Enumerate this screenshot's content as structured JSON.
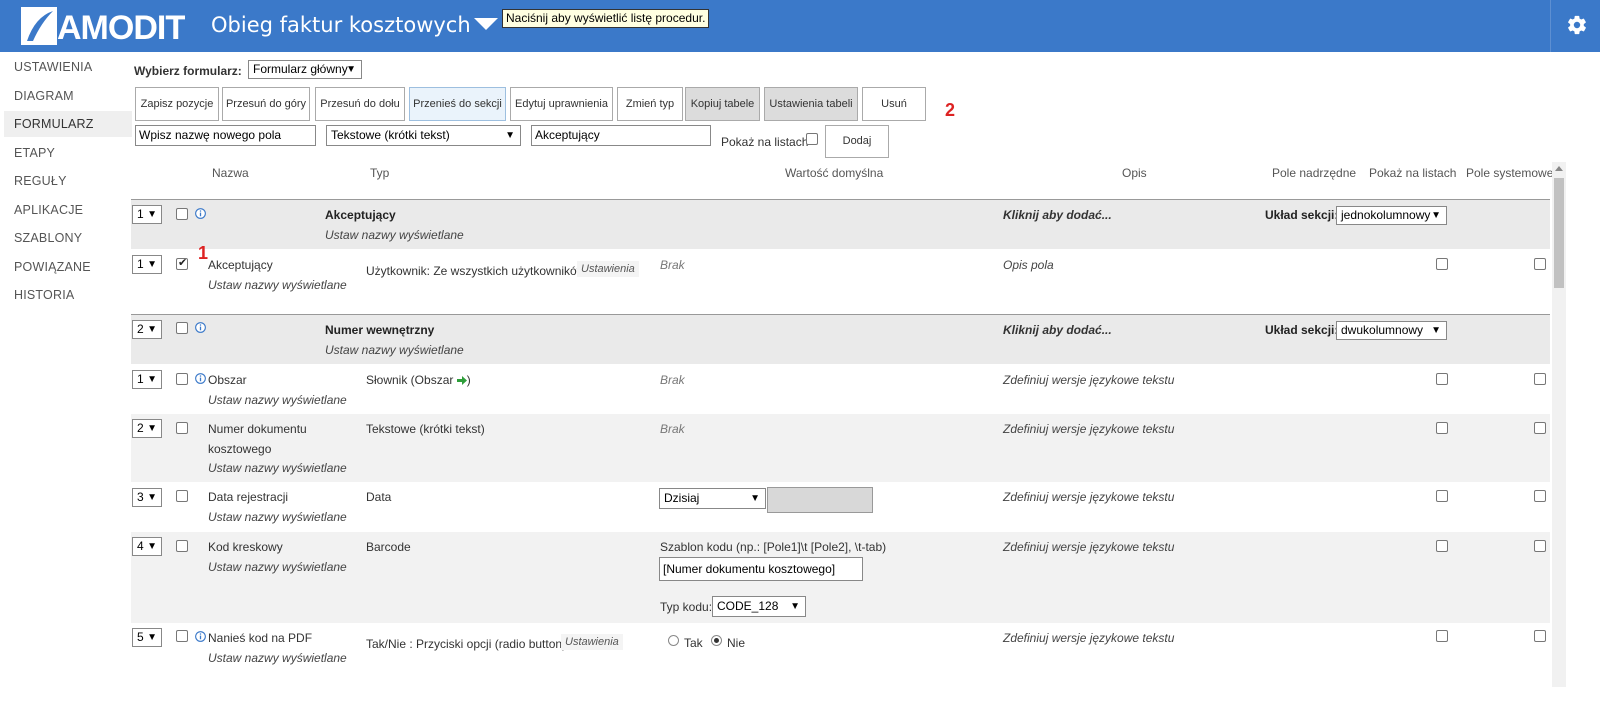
{
  "header": {
    "logo_text": "AMODIT",
    "title": "Obieg faktur kosztowych",
    "tooltip": "Naciśnij aby wyświetlić listę procedur.",
    "brand_color": "#3b79c9"
  },
  "sidebar": {
    "items": [
      {
        "label": "USTAWIENIA"
      },
      {
        "label": "DIAGRAM"
      },
      {
        "label": "FORMULARZ"
      },
      {
        "label": "ETAPY"
      },
      {
        "label": "REGUŁY"
      },
      {
        "label": "APLIKACJE"
      },
      {
        "label": "SZABLONY"
      },
      {
        "label": "POWIĄZANE"
      },
      {
        "label": "HISTORIA"
      }
    ],
    "active": "FORMULARZ"
  },
  "toolbar": {
    "form_label": "Wybierz formularz:",
    "form_value": "Formularz główny",
    "buttons": [
      {
        "label": "Zapisz pozycje"
      },
      {
        "label": "Przesuń do góry"
      },
      {
        "label": "Przesuń do dołu"
      },
      {
        "label": "Przenieś do sekcji"
      },
      {
        "label": "Edytuj uprawnienia"
      },
      {
        "label": "Zmień typ"
      },
      {
        "label": "Kopiuj tabele"
      },
      {
        "label": "Ustawienia tabeli"
      },
      {
        "label": "Usuń"
      }
    ],
    "marker_1": "1",
    "marker_2": "2",
    "new_field_placeholder": "Wpisz nazwę nowego pola",
    "type_value": "Tekstowe (krótki tekst)",
    "section_value": "Akceptujący",
    "show_on_lists_label": "Pokaż na listach",
    "add_label": "Dodaj"
  },
  "columns": {
    "nazwa": "Nazwa",
    "typ": "Typ",
    "wartosc": "Wartość domyślna",
    "opis": "Opis",
    "pole_nadrzedne": "Pole nadrzędne",
    "pokaz": "Pokaż na listach",
    "systemowe": "Pole systemowe"
  },
  "common": {
    "set_names": "Ustaw nazwy wyświetlane",
    "click_to_add": "Kliknij aby dodać...",
    "section_layout_label": "Układ sekcji:",
    "define_lang": "Zdefiniuj wersje językowe tekstu",
    "none": "Brak",
    "settings": "Ustawienia"
  },
  "rows": {
    "s1": {
      "num": "1",
      "name": "Akceptujący",
      "layout": "jednokolumnowy"
    },
    "r1": {
      "num": "1",
      "name": "Akceptujący",
      "type": "Użytkownik: Ze wszystkich użytkowników",
      "desc": "Opis pola"
    },
    "s2": {
      "num": "2",
      "name": "Numer wewnętrzny",
      "layout": "dwukolumnowy"
    },
    "r2": {
      "num": "1",
      "name": "Obszar",
      "type": "Słownik (Obszar",
      "type_end": ")"
    },
    "r3": {
      "num": "2",
      "name_line1": "Numer dokumentu",
      "name_line2": "kosztowego",
      "type": "Tekstowe (krótki tekst)"
    },
    "r4": {
      "num": "3",
      "name": "Data rejestracji",
      "type": "Data",
      "default": "Dzisiaj"
    },
    "r5": {
      "num": "4",
      "name": "Kod kreskowy",
      "type": "Barcode",
      "template_label": "Szablon kodu (np.: [Pole1]\\t [Pole2], \\t-tab)",
      "template_value": "[Numer dokumentu kosztowego]",
      "code_type_label": "Typ kodu:",
      "code_type_value": "CODE_128"
    },
    "r6": {
      "num": "5",
      "name": "Nanieś kod na PDF",
      "type": "Tak/Nie : Przyciski opcji (radio button)",
      "opt_yes": "Tak",
      "opt_no": "Nie"
    }
  }
}
